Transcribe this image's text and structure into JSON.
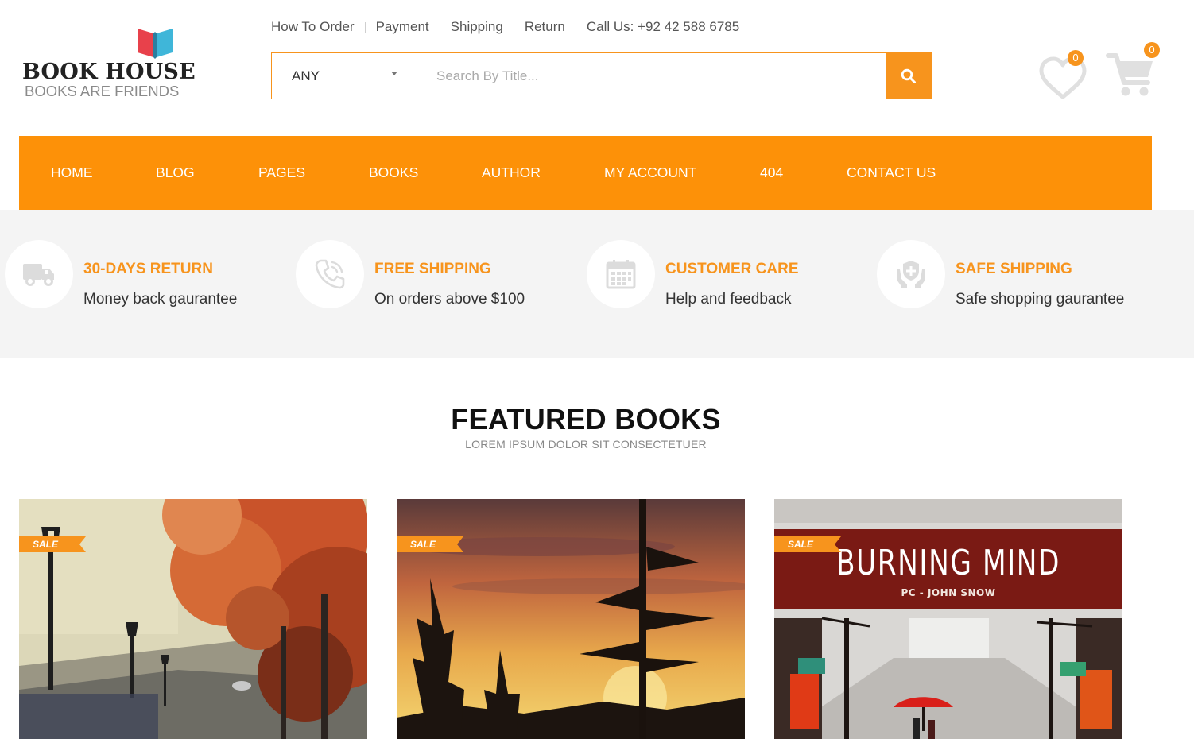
{
  "logo": {
    "title": "BOOK HOUSE",
    "subtitle": "BOOKS ARE FRIENDS"
  },
  "top_links": [
    "How To Order",
    "Payment",
    "Shipping",
    "Return",
    "Call Us: +92 42 588 6785"
  ],
  "search": {
    "category": "ANY",
    "placeholder": "Search By Title..."
  },
  "wishlist": {
    "count": "0",
    "icon": "heart-icon"
  },
  "cart": {
    "count": "0",
    "icon": "cart-icon"
  },
  "nav": [
    "HOME",
    "BLOG",
    "PAGES",
    "BOOKS",
    "AUTHOR",
    "MY ACCOUNT",
    "404",
    "CONTACT US"
  ],
  "features": [
    {
      "title": "30-DAYS RETURN",
      "text": "Money back gaurantee",
      "icon": "truck-icon"
    },
    {
      "title": "FREE SHIPPING",
      "text": "On orders above $100",
      "icon": "phone-icon"
    },
    {
      "title": "CUSTOMER CARE",
      "text": "Help and feedback",
      "icon": "calendar-icon"
    },
    {
      "title": "SAFE SHIPPING",
      "text": "Safe shopping gaurantee",
      "icon": "shield-hands-icon"
    }
  ],
  "featured": {
    "title": "FEATURED BOOKS",
    "subtitle": "LOREM IPSUM DOLOR SIT CONSECTETUER",
    "books": [
      {
        "badge": "SALE"
      },
      {
        "badge": "SALE"
      },
      {
        "badge": "SALE",
        "cover_title": "BURNING MIND",
        "cover_author": "PC - JOHN SNOW"
      }
    ]
  },
  "colors": {
    "accent": "#f7941d",
    "nav_bg": "#fd9108",
    "feature_bg": "#f4f4f4"
  }
}
